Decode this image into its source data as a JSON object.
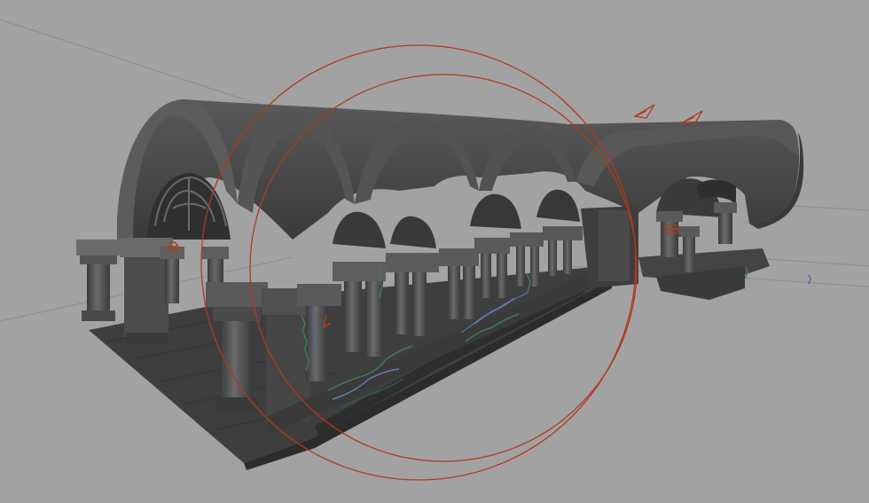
{
  "viewport": {
    "background_color": "#a2a2a2",
    "grid_line_color": "#8a8a8a",
    "model_color": "#4a4a4a",
    "model_highlight_color": "#6e6e6e",
    "model_shadow_color": "#2f2f2f",
    "floor_color": "#3e3e3e",
    "manipulator_color": "#b03a1a",
    "foliage_colors": [
      "#3c7a5e",
      "#4c6a9a",
      "#2f5a48",
      "#6a7ab0"
    ]
  },
  "objects": {
    "cloister_model": "vaulted-cloister-arcade",
    "light_manipulator": "rotate-manipulator-rings",
    "camera_icons": [
      "directional-light-icon",
      "directional-light-icon"
    ]
  }
}
